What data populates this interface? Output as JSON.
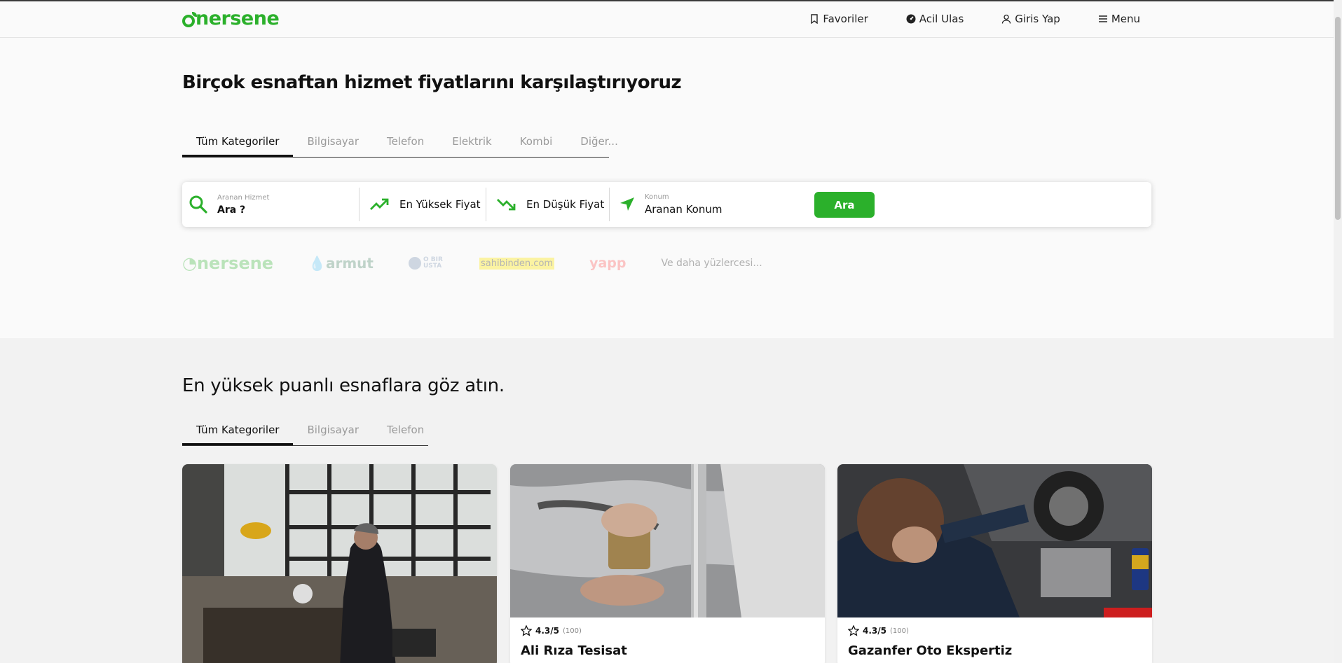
{
  "header": {
    "logo": "nersene",
    "nav": [
      {
        "label": "Favoriler",
        "icon": "bookmark-icon"
      },
      {
        "label": "Acil Ulas",
        "icon": "speedometer-icon"
      },
      {
        "label": "Giris Yap",
        "icon": "user-icon"
      },
      {
        "label": "Menu",
        "icon": "hamburger-icon"
      }
    ]
  },
  "hero": {
    "title": "Birçok esnaftan hizmet fiyatlarını karşılaştırıyoruz",
    "tabs": [
      "Tüm Kategoriler",
      "Bilgisayar",
      "Telefon",
      "Elektrik",
      "Kombi",
      "Diğer..."
    ],
    "active_tab": "Tüm Kategoriler"
  },
  "search": {
    "service_label": "Aranan Hizmet",
    "service_value": "Ara ?",
    "highest_price": "En Yüksek Fiyat",
    "lowest_price": "En Düşük Fiyat",
    "location_label": "Konum",
    "location_value": "Aranan Konum",
    "button": "Ara",
    "accent": "#2bb02b"
  },
  "brands": {
    "items": [
      "nersene",
      "armut",
      "O BIR USTA",
      "sahibinden.com",
      "yapp"
    ],
    "more": "Ve daha yüzlercesi..."
  },
  "top_rated": {
    "title": "En yüksek puanlı esnaflara göz atın.",
    "tabs": [
      "Tüm Kategoriler",
      "Bilgisayar",
      "Telefon"
    ],
    "active_tab": "Tüm Kategoriler",
    "cards": [
      {
        "name": "",
        "rating": "",
        "count": "",
        "image": "craftsman-workshop-photo"
      },
      {
        "name": "Ali Rıza Tesisat",
        "rating": "4.3/5",
        "count": "(100)",
        "image": "plumbing-pipe-photo"
      },
      {
        "name": "Gazanfer Oto Ekspertiz",
        "rating": "4.3/5",
        "count": "(100)",
        "image": "car-mechanic-photo"
      }
    ]
  }
}
